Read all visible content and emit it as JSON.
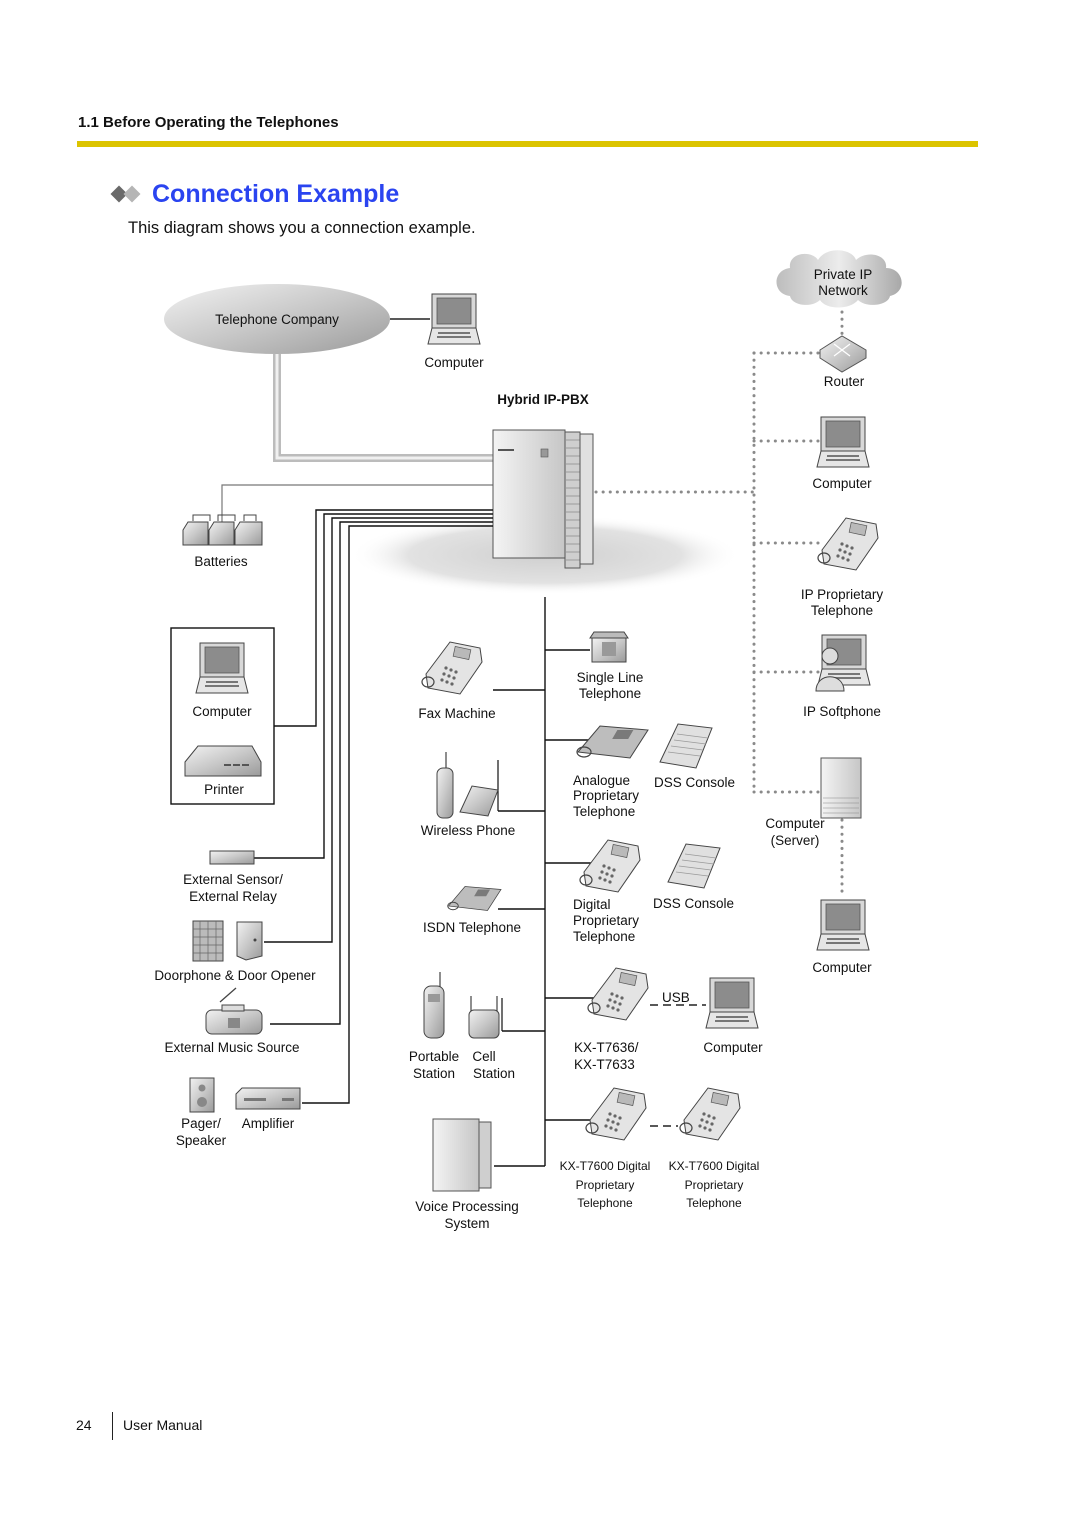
{
  "section": {
    "header": "1.1 Before Operating the Telephones"
  },
  "page": {
    "title": "Connection Example",
    "intro": "This diagram shows you a connection example."
  },
  "diagram": {
    "center": {
      "label": "Hybrid IP-PBX"
    },
    "telephone_company": {
      "label": "Telephone Company"
    },
    "top_computer": {
      "label": "Computer"
    },
    "batteries": {
      "label": "Batteries"
    },
    "left_group": {
      "computer": "Computer",
      "printer": "Printer",
      "external_sensor": [
        "External Sensor/",
        "External Relay"
      ],
      "doorphone": "Doorphone & Door Opener",
      "music": "External Music Source",
      "pager": [
        "Pager/",
        "Speaker"
      ],
      "amplifier": "Amplifier"
    },
    "middle_group": {
      "fax": "Fax Machine",
      "wireless": "Wireless Phone",
      "isdn": "ISDN Telephone",
      "portable": [
        "Portable",
        "Station"
      ],
      "cell": [
        "Cell",
        "Station"
      ],
      "voice_processing": [
        "Voice Processing",
        "System"
      ]
    },
    "extension_group": {
      "single_line": [
        "Single Line",
        "Telephone"
      ],
      "analogue": [
        "Analogue",
        "Proprietary",
        "Telephone"
      ],
      "dss1": "DSS Console",
      "digital": [
        "Digital",
        "Proprietary",
        "Telephone"
      ],
      "dss2": "DSS Console",
      "kx7636": [
        "KX-T7636/",
        "KX-T7633"
      ],
      "usb": "USB",
      "usb_computer": "Computer",
      "kx7600_a": [
        "KX-T7600 Digital",
        "Proprietary",
        "Telephone"
      ],
      "kx7600_b": [
        "KX-T7600 Digital",
        "Proprietary",
        "Telephone"
      ]
    },
    "ip_group": {
      "network": [
        "Private IP",
        "Network"
      ],
      "router": "Router",
      "computer": "Computer",
      "ip_phone": [
        "IP Proprietary",
        "Telephone"
      ],
      "softphone": "IP Softphone",
      "server": [
        "Computer",
        "(Server)"
      ],
      "bottom_computer": "Computer"
    }
  },
  "footer": {
    "page_number": "24",
    "label": "User Manual"
  },
  "colors": {
    "title_blue": "#2a44f0",
    "rule_yellow": "#dcc400"
  }
}
